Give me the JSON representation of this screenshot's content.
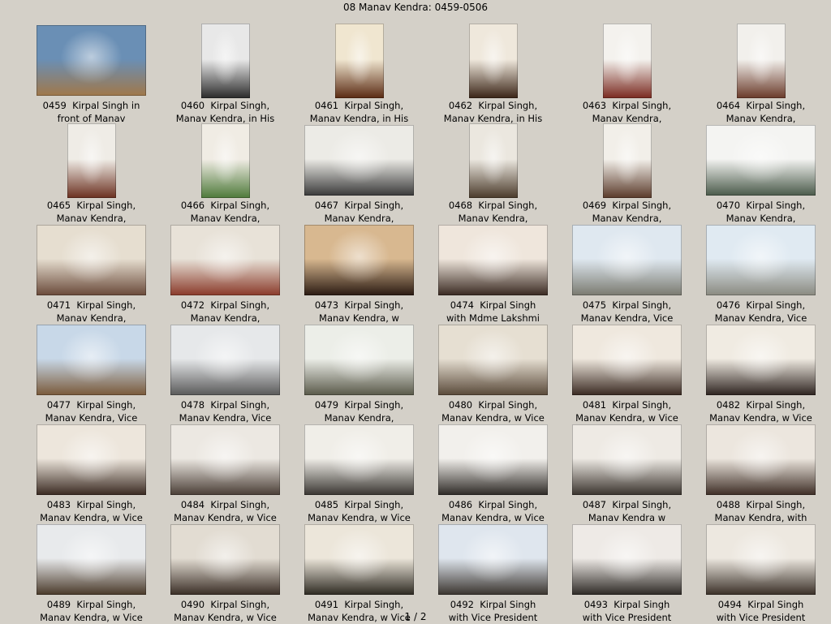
{
  "title": "08 Manav Kendra: 0459-0506",
  "pager": "1 / 2",
  "thumbnails": [
    {
      "caption": "0459  Kirpal Singh in\nfront of Manav",
      "orientation": "landscape",
      "palette": [
        "#6a8fb5",
        "#a0784a"
      ]
    },
    {
      "caption": "0460  Kirpal Singh,\nManav Kendra, in His",
      "orientation": "portrait",
      "palette": [
        "#e8e8e8",
        "#2a2a2a"
      ]
    },
    {
      "caption": "0461  Kirpal Singh,\nManav Kendra, in His",
      "orientation": "portrait",
      "palette": [
        "#f0e6d0",
        "#5a2a12"
      ]
    },
    {
      "caption": "0462  Kirpal Singh,\nManav Kendra, in His",
      "orientation": "portrait",
      "palette": [
        "#efe8dc",
        "#3a2416"
      ]
    },
    {
      "caption": "0463  Kirpal Singh,\nManav Kendra,",
      "orientation": "portrait",
      "palette": [
        "#f4f2ee",
        "#7a2a20"
      ]
    },
    {
      "caption": "0464  Kirpal Singh,\nManav Kendra,",
      "orientation": "portrait",
      "palette": [
        "#f2f0ec",
        "#6a3a2a"
      ]
    },
    {
      "caption": "0465  Kirpal Singh,\nManav Kendra,",
      "orientation": "portrait",
      "palette": [
        "#efece6",
        "#6b3020"
      ]
    },
    {
      "caption": "0466  Kirpal Singh,\nManav Kendra,",
      "orientation": "portrait",
      "palette": [
        "#f0ece4",
        "#4e7a3a"
      ]
    },
    {
      "caption": "0467  Kirpal Singh,\nManav Kendra,",
      "orientation": "landscape",
      "palette": [
        "#ecebe6",
        "#3a3a3a"
      ]
    },
    {
      "caption": "0468  Kirpal Singh,\nManav Kendra,",
      "orientation": "portrait",
      "palette": [
        "#ebe7df",
        "#4a3a2a"
      ]
    },
    {
      "caption": "0469  Kirpal Singh,\nManav Kendra,",
      "orientation": "portrait",
      "palette": [
        "#f2efe9",
        "#5a3a2a"
      ]
    },
    {
      "caption": "0470  Kirpal Singh,\nManav Kendra,",
      "orientation": "landscape",
      "palette": [
        "#f4f4f2",
        "#4a5a4a"
      ]
    },
    {
      "caption": "0471  Kirpal Singh,\nManav Kendra,",
      "orientation": "landscape",
      "palette": [
        "#e6ded0",
        "#6a4a3a"
      ]
    },
    {
      "caption": "0472  Kirpal Singh,\nManav Kendra,",
      "orientation": "landscape",
      "palette": [
        "#e8e2d8",
        "#8a3a2a"
      ]
    },
    {
      "caption": "0473  Kirpal Singh,\nManav Kendra, w",
      "orientation": "landscape",
      "palette": [
        "#d8b890",
        "#2a1a12"
      ]
    },
    {
      "caption": "0474  Kirpal Singh\nwith Mdme Lakshmi",
      "orientation": "landscape",
      "palette": [
        "#efe6dc",
        "#3a2a22"
      ]
    },
    {
      "caption": "0475  Kirpal Singh,\nManav Kendra, Vice",
      "orientation": "landscape",
      "palette": [
        "#dfe8f0",
        "#7a7a70"
      ]
    },
    {
      "caption": "0476  Kirpal Singh,\nManav Kendra, Vice",
      "orientation": "landscape",
      "palette": [
        "#e0eaf2",
        "#8a8a80"
      ]
    },
    {
      "caption": "0477  Kirpal Singh,\nManav Kendra, Vice",
      "orientation": "landscape",
      "palette": [
        "#c8d8e8",
        "#7a5a3a"
      ]
    },
    {
      "caption": "0478  Kirpal Singh,\nManav Kendra, Vice",
      "orientation": "landscape",
      "palette": [
        "#e6e8ea",
        "#5a5a5a"
      ]
    },
    {
      "caption": "0479  Kirpal Singh,\nManav Kendra,",
      "orientation": "landscape",
      "palette": [
        "#eceee8",
        "#5a5a4a"
      ]
    },
    {
      "caption": "0480  Kirpal Singh,\nManav Kendra, w Vice",
      "orientation": "landscape",
      "palette": [
        "#e6dfd2",
        "#5a4a3a"
      ]
    },
    {
      "caption": "0481  Kirpal Singh,\nManav Kendra, w Vice",
      "orientation": "landscape",
      "palette": [
        "#efe8de",
        "#3a2a22"
      ]
    },
    {
      "caption": "0482  Kirpal Singh,\nManav Kendra, w Vice",
      "orientation": "landscape",
      "palette": [
        "#f0ebe2",
        "#2e2420"
      ]
    },
    {
      "caption": "0483  Kirpal Singh,\nManav Kendra, w Vice",
      "orientation": "landscape",
      "palette": [
        "#ede6dc",
        "#3a2a22"
      ]
    },
    {
      "caption": "0484  Kirpal Singh,\nManav Kendra, w Vice",
      "orientation": "landscape",
      "palette": [
        "#ece8e2",
        "#4a3e36"
      ]
    },
    {
      "caption": "0485  Kirpal Singh,\nManav Kendra, w Vice",
      "orientation": "landscape",
      "palette": [
        "#f0eee8",
        "#3a3632"
      ]
    },
    {
      "caption": "0486  Kirpal Singh,\nManav Kendra, w Vice",
      "orientation": "landscape",
      "palette": [
        "#f2f0ec",
        "#2e2a26"
      ]
    },
    {
      "caption": "0487  Kirpal Singh,\nManav Kendra w",
      "orientation": "landscape",
      "palette": [
        "#eeeae4",
        "#3a342e"
      ]
    },
    {
      "caption": "0488  Kirpal Singh,\nManav Kendra, with",
      "orientation": "landscape",
      "palette": [
        "#ece6de",
        "#3e2e26"
      ]
    },
    {
      "caption": "0489  Kirpal Singh,\nManav Kendra, w Vice",
      "orientation": "landscape",
      "palette": [
        "#e8eaec",
        "#4a3a2a"
      ]
    },
    {
      "caption": "0490  Kirpal Singh,\nManav Kendra, w Vice",
      "orientation": "landscape",
      "palette": [
        "#e2dcd2",
        "#3a2e26"
      ]
    },
    {
      "caption": "0491  Kirpal Singh,\nManav Kendra, w Vice",
      "orientation": "landscape",
      "palette": [
        "#ece6da",
        "#2e2a22"
      ]
    },
    {
      "caption": "0492  Kirpal Singh\nwith Vice President",
      "orientation": "landscape",
      "palette": [
        "#dfe6ee",
        "#3a342e"
      ]
    },
    {
      "caption": "0493  Kirpal Singh\nwith Vice President",
      "orientation": "landscape",
      "palette": [
        "#eeeae6",
        "#2e2a26"
      ]
    },
    {
      "caption": "0494  Kirpal Singh\nwith Vice President",
      "orientation": "landscape",
      "palette": [
        "#ede8e0",
        "#3a3028"
      ]
    }
  ]
}
